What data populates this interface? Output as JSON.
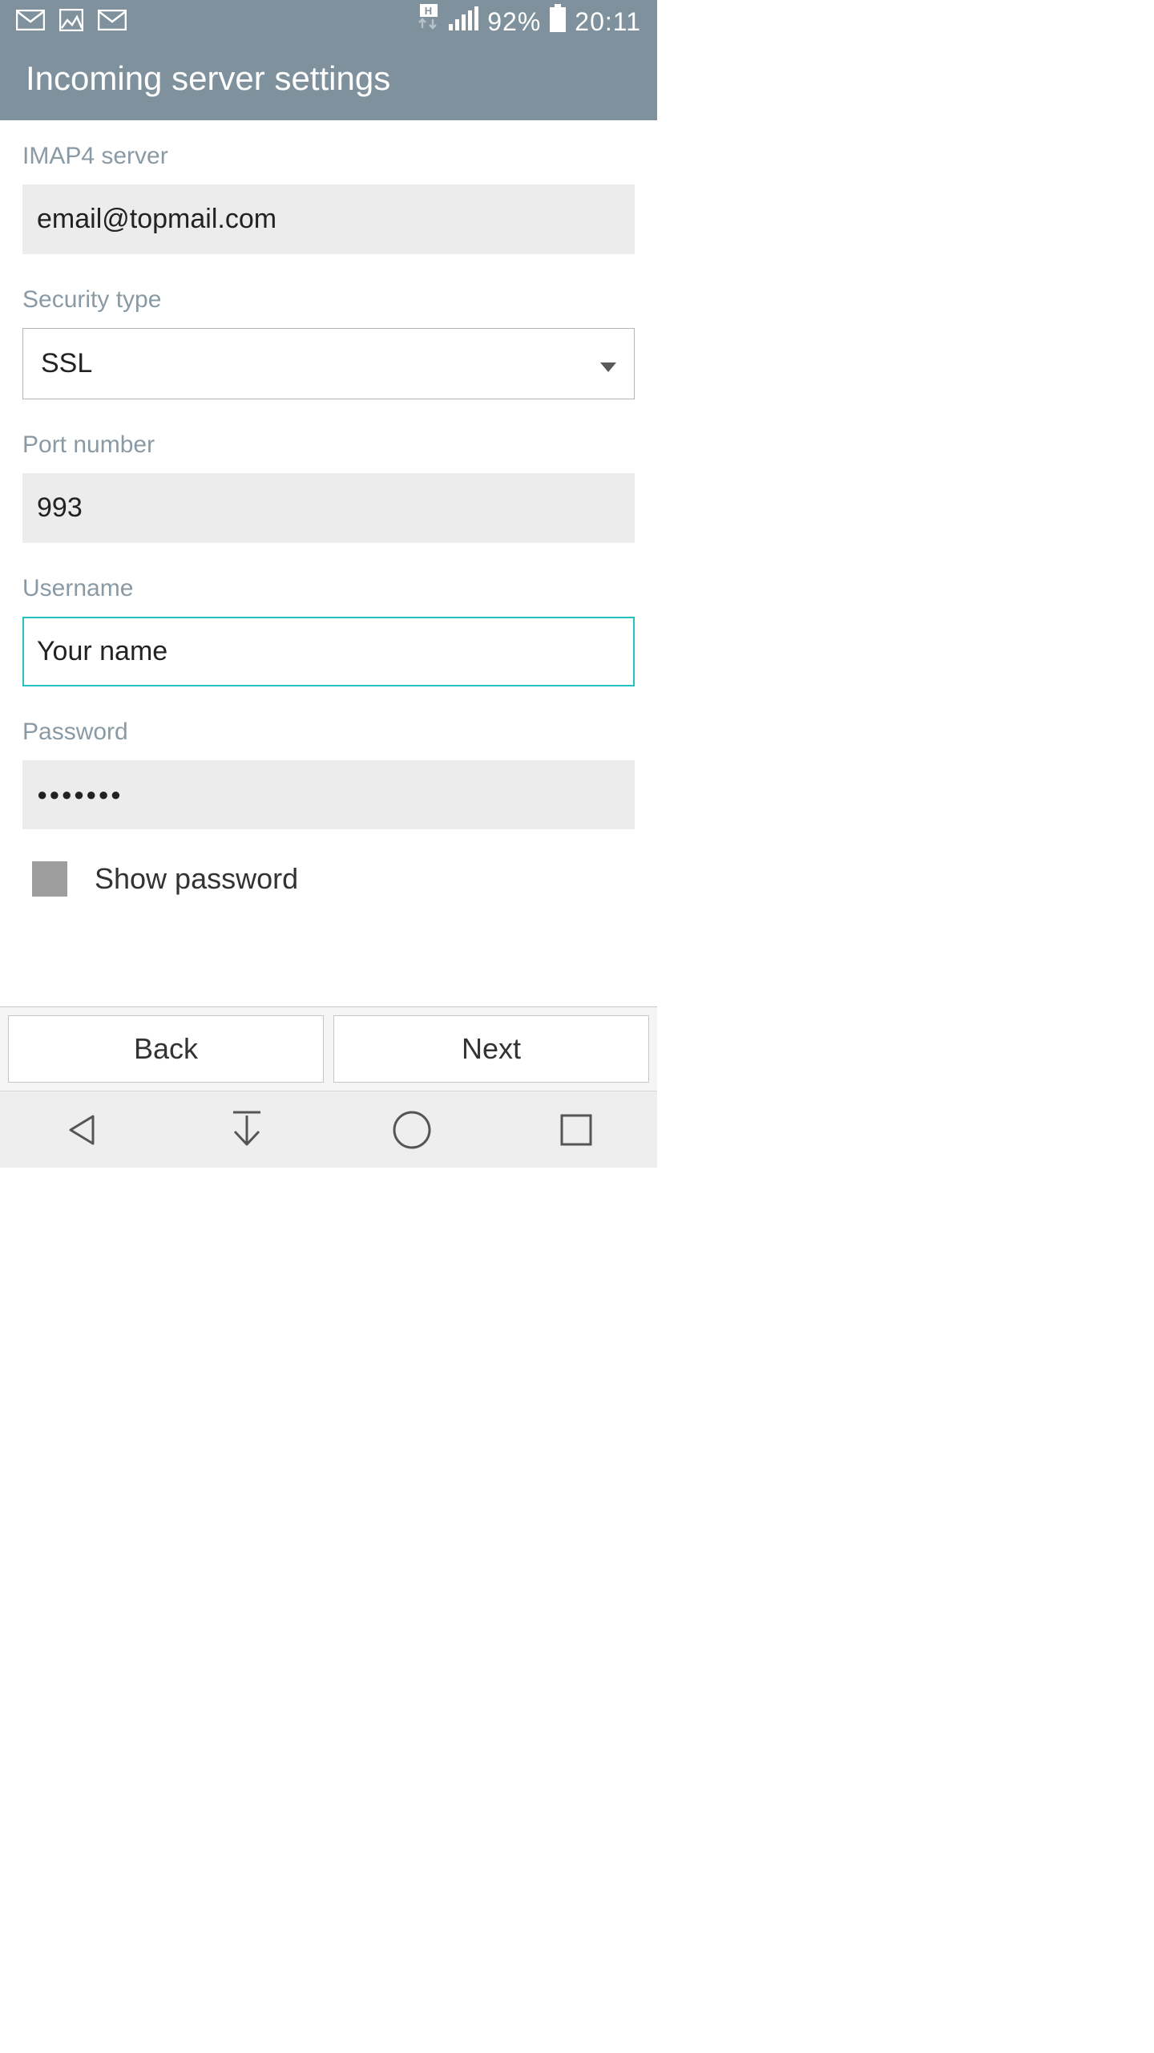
{
  "status_bar": {
    "battery_percent": "92%",
    "time": "20:11"
  },
  "header": {
    "title": "Incoming server settings"
  },
  "form": {
    "imap_label": "IMAP4 server",
    "imap_value": "email@topmail.com",
    "security_label": "Security type",
    "security_value": "SSL",
    "port_label": "Port number",
    "port_value": "993",
    "username_label": "Username",
    "username_value": "Your name",
    "password_label": "Password",
    "password_value": "●●●●●●●",
    "show_password_label": "Show password"
  },
  "buttons": {
    "back": "Back",
    "next": "Next"
  }
}
